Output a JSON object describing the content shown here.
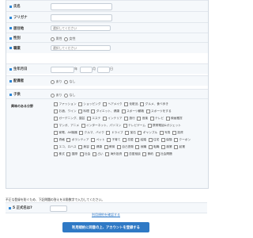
{
  "fields": {
    "name": "氏名",
    "furigana": "フリガナ",
    "residence": "居住地",
    "gender": "性別",
    "occupation": "職業",
    "birthdate": "生年月日",
    "marriage": "配偶者",
    "children": "子供",
    "interests": "興味のある分野",
    "is_over_18": "5 正式名は?"
  },
  "select_placeholder": "選択してください",
  "gender_options": [
    "男性",
    "女性"
  ],
  "yes_no": [
    "あり",
    "なし"
  ],
  "date_units": {
    "year": "年",
    "month": "月",
    "day": "日"
  },
  "interests_options": [
    [
      "ファッション",
      "ショッピング",
      "ヘアメイク",
      "化粧品",
      "グルメ、食べ歩き"
    ],
    [
      "お酒、ワイン",
      "料理",
      "ダイエット、健康",
      "スポーツ観戦",
      "スポーツをする"
    ],
    [
      "ガーデニング、園芸",
      "エステ",
      "インテリア",
      "旅行",
      "音楽",
      "テレビ",
      "映画鑑賞"
    ],
    [
      "マンガ、アニメ",
      "インターネット、パソコン",
      "テレビゲーム",
      "携帯電話&ガジェット"
    ],
    [
      "家電、AV機器",
      "クルマ、バイク",
      "ドライブ",
      "宝石",
      "ギャンブル",
      "写真",
      "投資"
    ],
    [
      "資格",
      "ボランティア",
      "ペット",
      "子育て",
      "恋愛",
      "結婚",
      "住宅",
      "保険",
      "クーポン"
    ],
    [
      "エコ、ロハス",
      "美容",
      "健康",
      "教育",
      "自己啓発",
      "就職",
      "転職",
      "副業",
      "起業"
    ],
    [
      "株式",
      "国際",
      "社会",
      "占い",
      "海外投資",
      "恋愛相談",
      "節約",
      "社会問題"
    ]
  ],
  "notice": "不正な登録を防ぐため、下記問題の答えを半角数字で入力してください。",
  "terms_link": "利用規約を確認する",
  "submit_label": "利用規約に同意の上、アカウントを登録する"
}
